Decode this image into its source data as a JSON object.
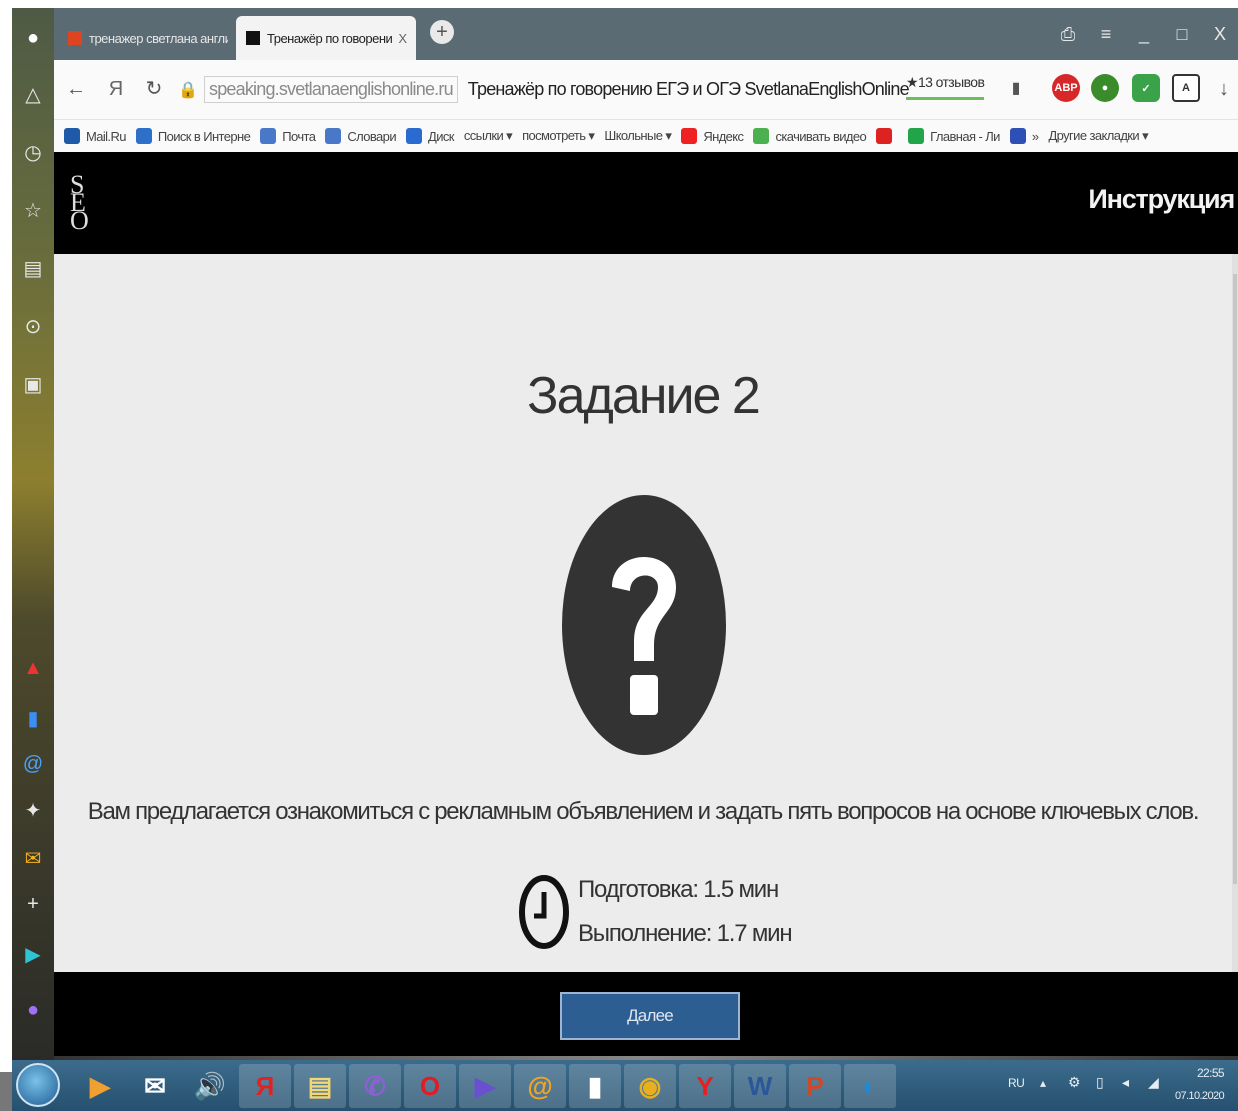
{
  "browser": {
    "tabs": [
      {
        "label": "тренажер светлана англи"
      },
      {
        "label": "Тренажёр по говорени",
        "close": "X"
      }
    ],
    "new_tab": "+",
    "window_controls": {
      "minimize": "_",
      "maximize": "□",
      "close": "X"
    },
    "url": "speaking.svetlanaenglishonline.ru",
    "page_title": "Тренажёр по говорению ЕГЭ и ОГЭ SvetlanaEnglishOnline",
    "reviews": "★13 отзывов"
  },
  "bookmarks": [
    {
      "label": "Mail.Ru",
      "icon": "mailru-icon",
      "color": "#1e5aa8"
    },
    {
      "label": "Поиск в Интерне",
      "icon": "search-icon",
      "color": "#2e6fc9"
    },
    {
      "label": "Почта",
      "icon": "mail-icon",
      "color": "#4a78c8"
    },
    {
      "label": "Словари",
      "icon": "dictionary-icon",
      "color": "#4a78c8"
    },
    {
      "label": "Диск",
      "icon": "disk-icon",
      "color": "#2a6bd1"
    },
    {
      "label": "ссылки ▾",
      "icon": "",
      "color": ""
    },
    {
      "label": "посмотреть ▾",
      "icon": "",
      "color": ""
    },
    {
      "label": "Школьные ▾",
      "icon": "",
      "color": ""
    },
    {
      "label": "Яндекс",
      "icon": "yandex-icon",
      "color": "#e22"
    },
    {
      "label": "скачивать видео",
      "icon": "download-arrow-icon",
      "color": "#4caf50"
    },
    {
      "label": "",
      "icon": "youtube-icon",
      "color": "#d22"
    },
    {
      "label": "Главная - Ли",
      "icon": "green-leaf-icon",
      "color": "#22a44a"
    },
    {
      "label": "»",
      "icon": "russia-flag-icon",
      "color": "#2e4fb5"
    },
    {
      "label": "Другие закладки ▾",
      "icon": "",
      "color": ""
    }
  ],
  "site": {
    "header_link": "Инструкция",
    "task_title": "Задание 2",
    "description": "Вам предлагается ознакомиться с рекламным объявлением и задать пять вопросов на основе ключевых слов.",
    "preparation": "Подготовка: 1.5 мин",
    "execution": "Выполнение: 1.7 мин",
    "next_button": "Далее"
  },
  "taskbar": {
    "items": [
      {
        "icon": "media-player-icon",
        "glyph": "▶",
        "color": "#f0a030"
      },
      {
        "icon": "mail-icon",
        "glyph": "✉",
        "color": "#ffffff"
      },
      {
        "icon": "speaker-icon",
        "glyph": "🔊",
        "color": "#ffffff"
      },
      {
        "icon": "yandex-browser-icon",
        "glyph": "Я",
        "color": "#e22222"
      },
      {
        "icon": "folder-icon",
        "glyph": "▤",
        "color": "#f3d774"
      },
      {
        "icon": "viber-icon",
        "glyph": "✆",
        "color": "#8f5fd6"
      },
      {
        "icon": "opera-icon",
        "glyph": "O",
        "color": "#e51b24"
      },
      {
        "icon": "play-icon",
        "glyph": "▶",
        "color": "#6a4fd0"
      },
      {
        "icon": "mail-agent-icon",
        "glyph": "@",
        "color": "#f3a521"
      },
      {
        "icon": "document-icon",
        "glyph": "▮",
        "color": "#ffffff"
      },
      {
        "icon": "chrome-icon",
        "glyph": "◉",
        "color": "#e8b020"
      },
      {
        "icon": "yandex-icon",
        "glyph": "Y",
        "color": "#e22222"
      },
      {
        "icon": "word-icon",
        "glyph": "W",
        "color": "#2b579a"
      },
      {
        "icon": "powerpoint-icon",
        "glyph": "P",
        "color": "#d24726"
      },
      {
        "icon": "zoom-icon",
        "glyph": "◐",
        "color": "#1d8bd8"
      }
    ],
    "language": "RU",
    "time": "22:55",
    "date": "07.10.2020"
  }
}
